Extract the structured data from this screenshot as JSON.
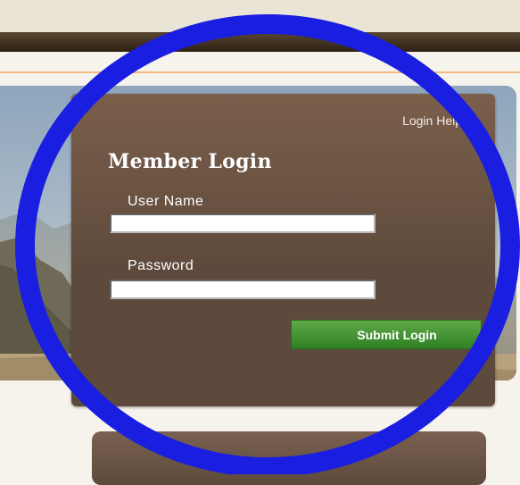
{
  "login": {
    "help_link": "Login Help",
    "title": "Member Login",
    "username_label": "User Name",
    "username_value": "",
    "password_label": "Password",
    "password_value": "",
    "submit_label": "Submit Login"
  },
  "colors": {
    "panel": "#5d4a3c",
    "submit_button": "#3f9130",
    "annotation_circle": "#1a1ee0",
    "header_bar": "#3b2b1a",
    "accent_rule": "#f3b985"
  },
  "icons": {
    "annotation": "blue-circle-outline"
  }
}
